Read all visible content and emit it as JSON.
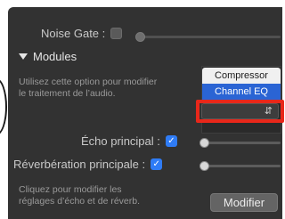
{
  "noise_gate": {
    "label": "Noise Gate :",
    "enabled": false,
    "level": 0
  },
  "modules": {
    "header": "Modules",
    "description_line1": "Utilisez cette option pour modifier",
    "description_line2": "le traitement de l’audio.",
    "list_items": [
      "Compressor",
      "Channel EQ"
    ],
    "selected_index": 1,
    "dropdown_value": ""
  },
  "echo": {
    "label": "Écho principal :",
    "enabled": true,
    "level": 0
  },
  "reverb": {
    "label": "Réverbération principale :",
    "enabled": true,
    "level": 0
  },
  "footer": {
    "note_line1": "Cliquez pour modifier les",
    "note_line2": "réglages d’écho et de réverb.",
    "button_label": "Modifier"
  },
  "colors": {
    "accent": "#2f7cf6",
    "highlight": "#e8271a",
    "panel": "#323232"
  },
  "icons": {
    "checkbox_checked": "checkmark-icon",
    "disclosure": "disclosure-triangle-icon",
    "dropdown": "updown-chevron-icon"
  }
}
